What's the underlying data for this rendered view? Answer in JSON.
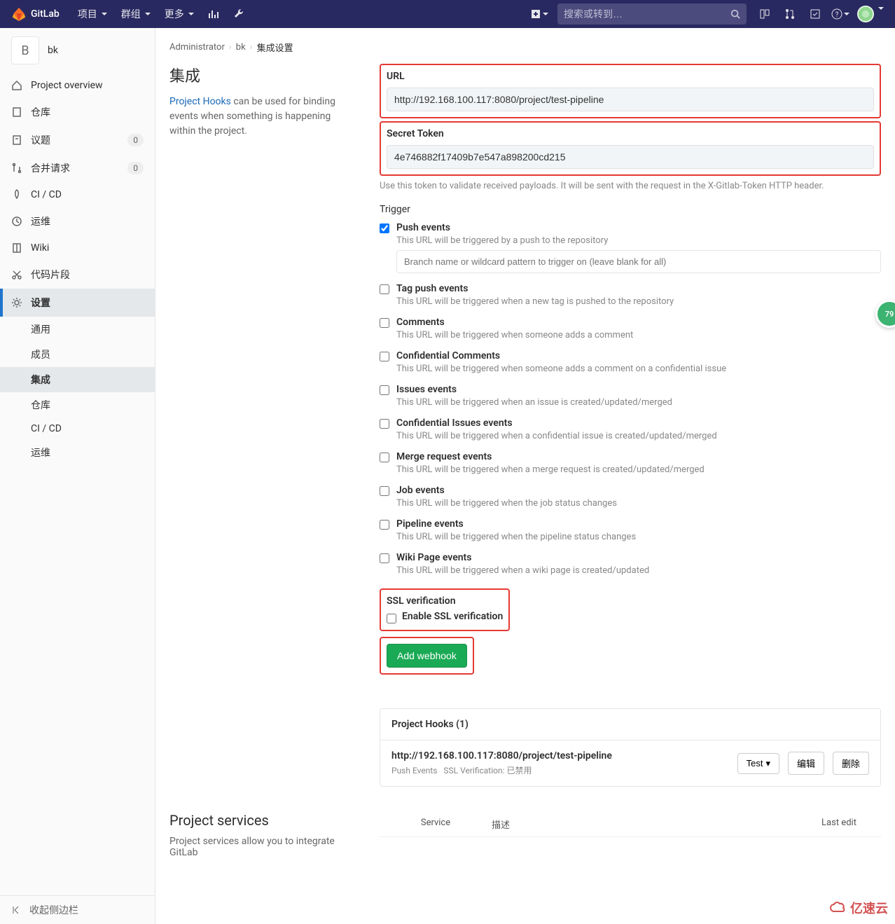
{
  "colors": {
    "navbar": "#292961",
    "accent_green": "#1aaa55",
    "link": "#1b69b6",
    "highlight_red": "#e53935"
  },
  "topnav": {
    "brand": "GitLab",
    "items": [
      "项目",
      "群组",
      "更多"
    ],
    "search_placeholder": "搜索或转到…",
    "plus_icon": "plus-dropdown",
    "right_icons": [
      "issues-icon",
      "merge-requests-icon",
      "todos-icon",
      "help-icon"
    ]
  },
  "sidebar": {
    "context": {
      "avatar_letter": "B",
      "name": "bk"
    },
    "items": [
      {
        "icon": "home-icon",
        "label": "Project overview"
      },
      {
        "icon": "repo-icon",
        "label": "仓库"
      },
      {
        "icon": "issues-icon",
        "label": "议题",
        "badge": "0"
      },
      {
        "icon": "mr-icon",
        "label": "合并请求",
        "badge": "0"
      },
      {
        "icon": "rocket-icon",
        "label": "CI / CD"
      },
      {
        "icon": "ops-icon",
        "label": "运维"
      },
      {
        "icon": "book-icon",
        "label": "Wiki"
      },
      {
        "icon": "scissors-icon",
        "label": "代码片段"
      },
      {
        "icon": "gear-icon",
        "label": "设置",
        "active": true
      }
    ],
    "subitems": [
      {
        "label": "通用"
      },
      {
        "label": "成员"
      },
      {
        "label": "集成",
        "active": true
      },
      {
        "label": "仓库"
      },
      {
        "label": "CI / CD"
      },
      {
        "label": "运维"
      }
    ],
    "collapse": "收起侧边栏"
  },
  "breadcrumbs": {
    "root": "Administrator",
    "project": "bk",
    "page": "集成设置"
  },
  "intro": {
    "title": "集成",
    "link_text": "Project Hooks",
    "desc_rest": " can be used for binding events when something is happening within the project."
  },
  "form": {
    "url_label": "URL",
    "url_value": "http://192.168.100.117:8080/project/test-pipeline",
    "token_label": "Secret Token",
    "token_value": "4e746882f17409b7e547a898200cd215",
    "token_help": "Use this token to validate received payloads. It will be sent with the request in the X-Gitlab-Token HTTP header.",
    "trigger_label": "Trigger",
    "branch_placeholder": "Branch name or wildcard pattern to trigger on (leave blank for all)",
    "ssl": {
      "heading": "SSL verification",
      "label": "Enable SSL verification"
    },
    "submit": "Add webhook"
  },
  "triggers": [
    {
      "checked": true,
      "label": "Push events",
      "desc": "This URL will be triggered by a push to the repository",
      "has_branch_input": true
    },
    {
      "checked": false,
      "label": "Tag push events",
      "desc": "This URL will be triggered when a new tag is pushed to the repository"
    },
    {
      "checked": false,
      "label": "Comments",
      "desc": "This URL will be triggered when someone adds a comment"
    },
    {
      "checked": false,
      "label": "Confidential Comments",
      "desc": "This URL will be triggered when someone adds a comment on a confidential issue"
    },
    {
      "checked": false,
      "label": "Issues events",
      "desc": "This URL will be triggered when an issue is created/updated/merged"
    },
    {
      "checked": false,
      "label": "Confidential Issues events",
      "desc": "This URL will be triggered when a confidential issue is created/updated/merged"
    },
    {
      "checked": false,
      "label": "Merge request events",
      "desc": "This URL will be triggered when a merge request is created/updated/merged"
    },
    {
      "checked": false,
      "label": "Job events",
      "desc": "This URL will be triggered when the job status changes"
    },
    {
      "checked": false,
      "label": "Pipeline events",
      "desc": "This URL will be triggered when the pipeline status changes"
    },
    {
      "checked": false,
      "label": "Wiki Page events",
      "desc": "This URL will be triggered when a wiki page is created/updated"
    }
  ],
  "hooks_panel": {
    "title": "Project Hooks (1)",
    "url": "http://192.168.100.117:8080/project/test-pipeline",
    "meta_push": "Push Events",
    "meta_ssl": "SSL Verification: 已禁用",
    "test_btn": "Test",
    "edit_btn": "编辑",
    "delete_btn": "删除"
  },
  "services": {
    "title": "Project services",
    "desc": "Project services allow you to integrate GitLab",
    "th_service": "Service",
    "th_desc": "描述",
    "th_last": "Last edit"
  },
  "floating_badge": "79",
  "watermark": "亿速云"
}
